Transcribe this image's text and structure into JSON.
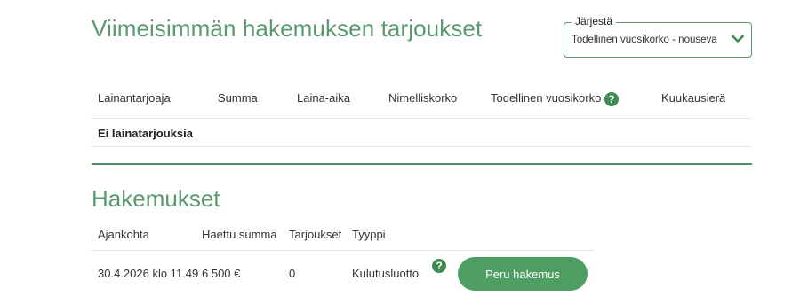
{
  "offers": {
    "title": "Viimeisimmän hakemuksen tarjoukset",
    "sort": {
      "label": "Järjestä",
      "selected": "Todellinen vuosikorko - nouseva",
      "chevron_icon": "chevron-down-icon"
    },
    "columns": [
      "Lainantarjoaja",
      "Summa",
      "Laina-aika",
      "Nimelliskorko",
      "Todellinen vuosikorko",
      "Kuukausierä"
    ],
    "help_icon": "?",
    "empty_text": "Ei lainatarjouksia"
  },
  "applications": {
    "title": "Hakemukset",
    "columns": [
      "Ajankohta",
      "Haettu summa",
      "Tarjoukset",
      "Tyyppi"
    ],
    "rows": [
      {
        "date": "30.4.2026 klo 11.49",
        "amount": "6 500 €",
        "offers": "0",
        "type": "Kulutusluotto",
        "help_icon": "?",
        "cancel_label": "Peru hakemus"
      }
    ]
  },
  "colors": {
    "accent": "#5a9a6e",
    "button": "#4e9d63",
    "icon": "#3c8c4f"
  }
}
